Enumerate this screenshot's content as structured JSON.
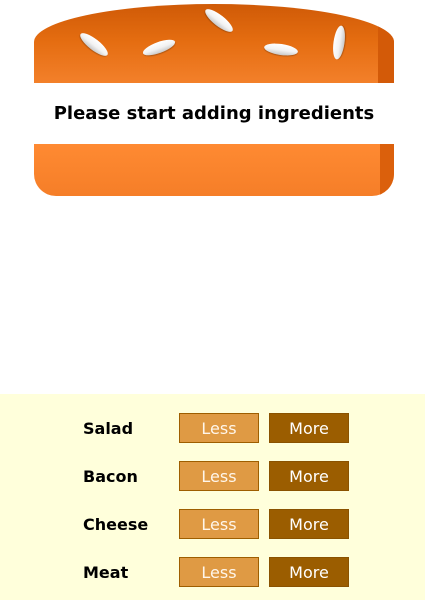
{
  "burger": {
    "message": "Please start adding ingredients"
  },
  "controls": [
    {
      "label": "Salad",
      "less": "Less",
      "more": "More"
    },
    {
      "label": "Bacon",
      "less": "Less",
      "more": "More"
    },
    {
      "label": "Cheese",
      "less": "Less",
      "more": "More"
    },
    {
      "label": "Meat",
      "less": "Less",
      "more": "More"
    }
  ],
  "colors": {
    "bread": "#e46c10",
    "controls_background": "#ffffdb",
    "less_button": "#df9a44",
    "more_button": "#9b5d00"
  }
}
